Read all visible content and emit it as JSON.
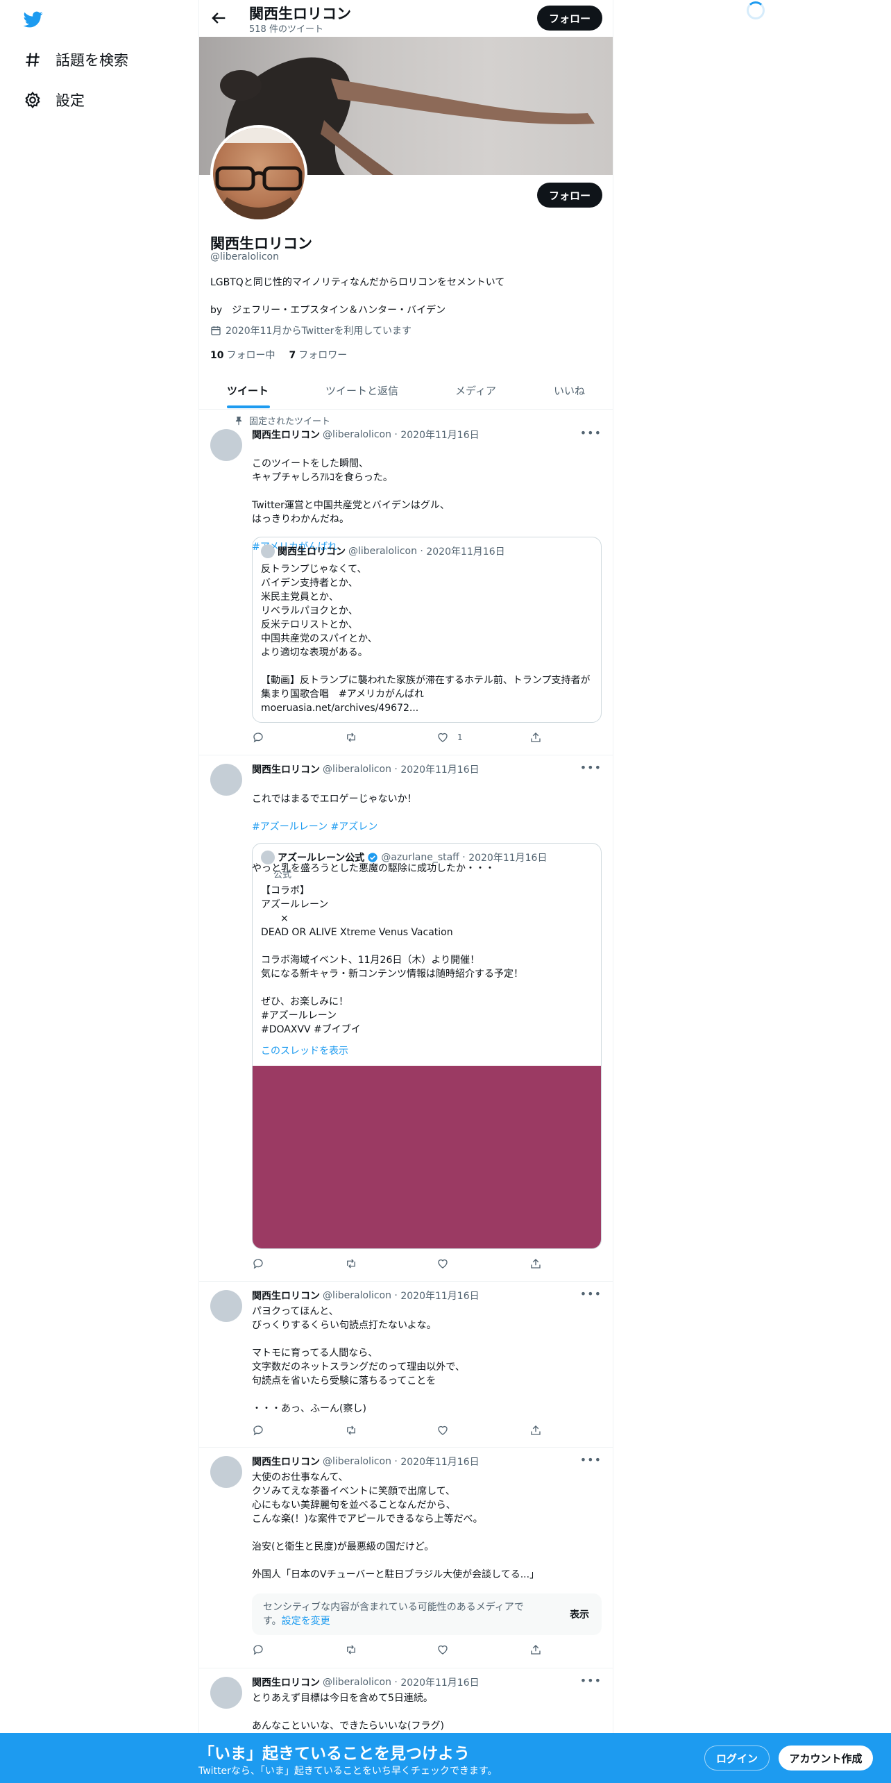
{
  "nav": {
    "explore_label": "話題を検索",
    "settings_label": "設定"
  },
  "header": {
    "name": "関西生ロリコン",
    "tweet_count": "518 件のツイート",
    "follow_label": "フォロー"
  },
  "profile": {
    "name": "関西生ロリコン",
    "handle": "@liberalolicon",
    "bio": "LGBTQと同じ性的マイノリティなんだからロリコンをセメントいて",
    "byline": "by　ジェフリー・エプスタイン＆ハンター・バイデン",
    "joined": "2020年11月からTwitterを利用しています",
    "following_count": "10",
    "following_label": "フォロー中",
    "followers_count": "7",
    "followers_label": "フォロワー",
    "follow_label": "フォロー"
  },
  "tabs": [
    "ツイート",
    "ツイートと返信",
    "メディア",
    "いいね"
  ],
  "tweets": [
    {
      "pinned_label": "固定されたツイート",
      "name": "関西生ロリコン",
      "handle": "@liberalolicon",
      "date": "2020年11月16日",
      "text": "このツイートをした瞬間、\nキャプチャしろｱﾙｺを食らった。\n\nTwitter運営と中国共産党とバイデンはグル、\nはっきりわかんだね。",
      "hashtag": "#アメリカがんばれ",
      "quote": {
        "name": "関西生ロリコン",
        "handle": "@liberalolicon",
        "date": "2020年11月16日",
        "text": "反トランプじゃなくて、\nバイデン支持者とか、\n米民主党員とか、\nリベラルパヨクとか、\n反米テロリストとか、\n中国共産党のスパイとか、\nより適切な表現がある。\n\n【動画】反トランプに襲われた家族が滞在するホテル前、トランプ支持者が集まり国歌合唱　#アメリカがんばれ\nmoeruasia.net/archives/49672..."
      },
      "like_count": "1"
    },
    {
      "name": "関西生ロリコン",
      "handle": "@liberalolicon",
      "date": "2020年11月16日",
      "text": "これではまるでエロゲーじゃないか！",
      "hashtags": "#アズールレーン #アズレン",
      "text2": "やっと乳を盛ろうとした悪魔の駆除に成功したか・・・",
      "quote": {
        "name": "アズールレーン公式",
        "handle": "@azurlane_staff",
        "date": "2020年11月16日",
        "official": "公式",
        "text": "【コラボ】\nアズールレーン\n　　×\nDEAD OR ALIVE Xtreme Venus Vacation\n\nコラボ海域イベント、11月26日（木）より開催！\n気になる新キャラ・新コンテンツ情報は随時紹介する予定！\n\nぜひ、お楽しみに！\n#アズールレーン\n#DOAXVV #ブイブイ",
        "thread_link": "このスレッドを表示",
        "media_color": "#9b3a63"
      }
    },
    {
      "name": "関西生ロリコン",
      "handle": "@liberalolicon",
      "date": "2020年11月16日",
      "text": "パヨクってほんと、\nびっくりするくらい句読点打たないよな。\n\nマトモに育ってる人間なら、\n文字数だのネットスラングだのって理由以外で、\n句読点を省いたら受験に落ちるってことを\n\n・・・あっ、ふーん(察し)"
    },
    {
      "name": "関西生ロリコン",
      "handle": "@liberalolicon",
      "date": "2020年11月16日",
      "text": "大使のお仕事なんて、\nクソみてえな茶番イベントに笑顔で出席して、\n心にもない美辞麗句を並べることなんだから、\nこんな楽(！)な案件でアピールできるなら上等だべ。\n\n治安(と衛生と民度)が最悪級の国だけど。\n\n外国人「日本のVチューバーと駐日ブラジル大使が会談してる...」",
      "sensitive_text": "センシティブな内容が含まれている可能性のあるメディアです。",
      "sensitive_link": "設定を変更",
      "sensitive_button": "表示"
    },
    {
      "name": "関西生ロリコン",
      "handle": "@liberalolicon",
      "date": "2020年11月16日",
      "text": "とりあえず目標は今日を含めて5日連続。\n\nあんなこといいな、できたらいいな(フラグ)"
    }
  ],
  "bottom_bar": {
    "title": "「いま」起きていることを見つけよう",
    "subtitle": "Twitterなら、「いま」起きていることをいち早くチェックできます。",
    "login_label": "ログイン",
    "signup_label": "アカウント作成"
  },
  "colors": {
    "accent": "#1d9bf0",
    "dark": "#0f1419",
    "muted": "#536471"
  }
}
